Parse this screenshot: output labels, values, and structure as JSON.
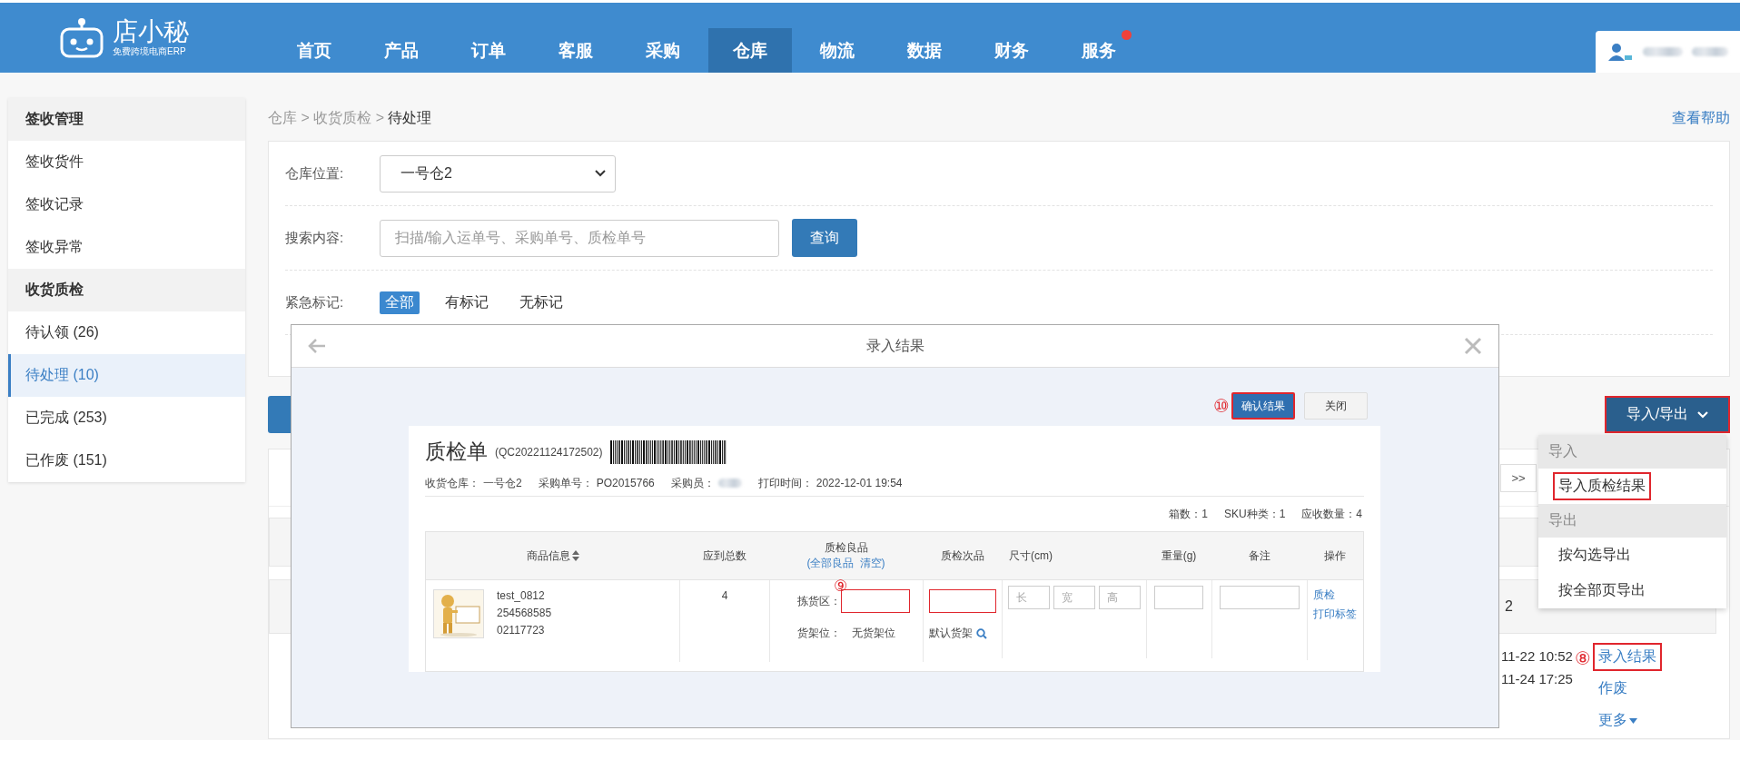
{
  "header": {
    "logo": {
      "name": "店小秘",
      "tagline": "免费跨境电商ERP"
    },
    "nav": [
      {
        "label": "首页",
        "selected": false,
        "badge": false
      },
      {
        "label": "产品",
        "selected": false,
        "badge": false
      },
      {
        "label": "订单",
        "selected": false,
        "badge": false
      },
      {
        "label": "客服",
        "selected": false,
        "badge": false
      },
      {
        "label": "采购",
        "selected": false,
        "badge": false
      },
      {
        "label": "仓库",
        "selected": true,
        "badge": false
      },
      {
        "label": "物流",
        "selected": false,
        "badge": false
      },
      {
        "label": "数据",
        "selected": false,
        "badge": false
      },
      {
        "label": "财务",
        "selected": false,
        "badge": false
      },
      {
        "label": "服务",
        "selected": false,
        "badge": true
      }
    ]
  },
  "sidebar": {
    "groups": [
      {
        "title": "签收管理",
        "items": [
          {
            "label": "签收货件",
            "selected": false
          },
          {
            "label": "签收记录",
            "selected": false
          },
          {
            "label": "签收异常",
            "selected": false
          }
        ]
      },
      {
        "title": "收货质检",
        "items": [
          {
            "label": "待认领 (26)",
            "selected": false
          },
          {
            "label": "待处理 (10)",
            "selected": true
          },
          {
            "label": "已完成 (253)",
            "selected": false
          },
          {
            "label": "已作废 (151)",
            "selected": false
          }
        ]
      }
    ]
  },
  "breadcrumb": {
    "items": [
      "仓库",
      "收货质检",
      "待处理"
    ],
    "separator": ">"
  },
  "help_link": "查看帮助",
  "filters": {
    "warehouse": {
      "label": "仓库位置:",
      "value": "一号仓2"
    },
    "search": {
      "label": "搜索内容:",
      "placeholder": "扫描/输入运单号、采购单号、质检单号",
      "button": "查询"
    },
    "urgency": {
      "label": "紧急标记:",
      "options": [
        {
          "label": "全部",
          "selected": true
        },
        {
          "label": "有标记",
          "selected": false
        },
        {
          "label": "无标记",
          "selected": false
        }
      ]
    }
  },
  "import_export": {
    "label": "导入/导出",
    "highlighted": true,
    "menu": [
      {
        "kind": "header",
        "label": "导入"
      },
      {
        "kind": "item",
        "label": "导入质检结果",
        "highlighted": true
      },
      {
        "kind": "header",
        "label": "导出"
      },
      {
        "kind": "item",
        "label": "按勾选导出",
        "highlighted": false
      },
      {
        "kind": "item",
        "label": "按全部页导出",
        "highlighted": false
      }
    ]
  },
  "list": {
    "pager_next": ">>",
    "group_text": "2",
    "row": {
      "times": [
        "11-22 10:52",
        "11-24 17:25"
      ],
      "marker": "⑧",
      "actions": [
        {
          "label": "录入结果",
          "highlighted": true,
          "dropdown": false
        },
        {
          "label": "作废",
          "highlighted": false,
          "dropdown": false
        },
        {
          "label": "更多",
          "highlighted": false,
          "dropdown": true
        }
      ]
    }
  },
  "modal": {
    "title": "录入结果",
    "confirm": {
      "marker": "⑩",
      "label": "确认结果",
      "highlighted": true
    },
    "close": "关闭",
    "sheet": {
      "title": "质检单",
      "code": "(QC20221124172502)",
      "info": [
        {
          "label": "收货仓库：",
          "value": "一号仓2",
          "blurred": false
        },
        {
          "label": "采购单号：",
          "value": "PO2015766",
          "blurred": false
        },
        {
          "label": "采购员：",
          "blurred": true
        },
        {
          "label": "打印时间：",
          "value": "2022-12-01 19:54",
          "blurred": false
        }
      ],
      "stats": [
        {
          "label": "箱数：",
          "value": "1"
        },
        {
          "label": "SKU种类：",
          "value": "1"
        },
        {
          "label": "应收数量：",
          "value": "4"
        }
      ],
      "columns": [
        "商品信息",
        "应到总数",
        "质检良品",
        "质检次品",
        "尺寸(cm)",
        "重量(g)",
        "备注",
        "操作"
      ],
      "good_actions": {
        "prefix": "(",
        "links": [
          "全部良品",
          "清空"
        ],
        "suffix": ")"
      },
      "rows": [
        {
          "sku": "test_0812",
          "lines": [
            "254568585",
            "02117723"
          ],
          "expected": "4",
          "pick_label": "拣货区：",
          "marker": "⑨",
          "highlighted": true,
          "shelf_label": "货架位：",
          "shelf_value": "无货架位",
          "default_shelf": "默认货架",
          "size_placeholders": [
            "长",
            "宽",
            "高"
          ],
          "actions": [
            "质检",
            "打印标签"
          ]
        }
      ]
    }
  }
}
